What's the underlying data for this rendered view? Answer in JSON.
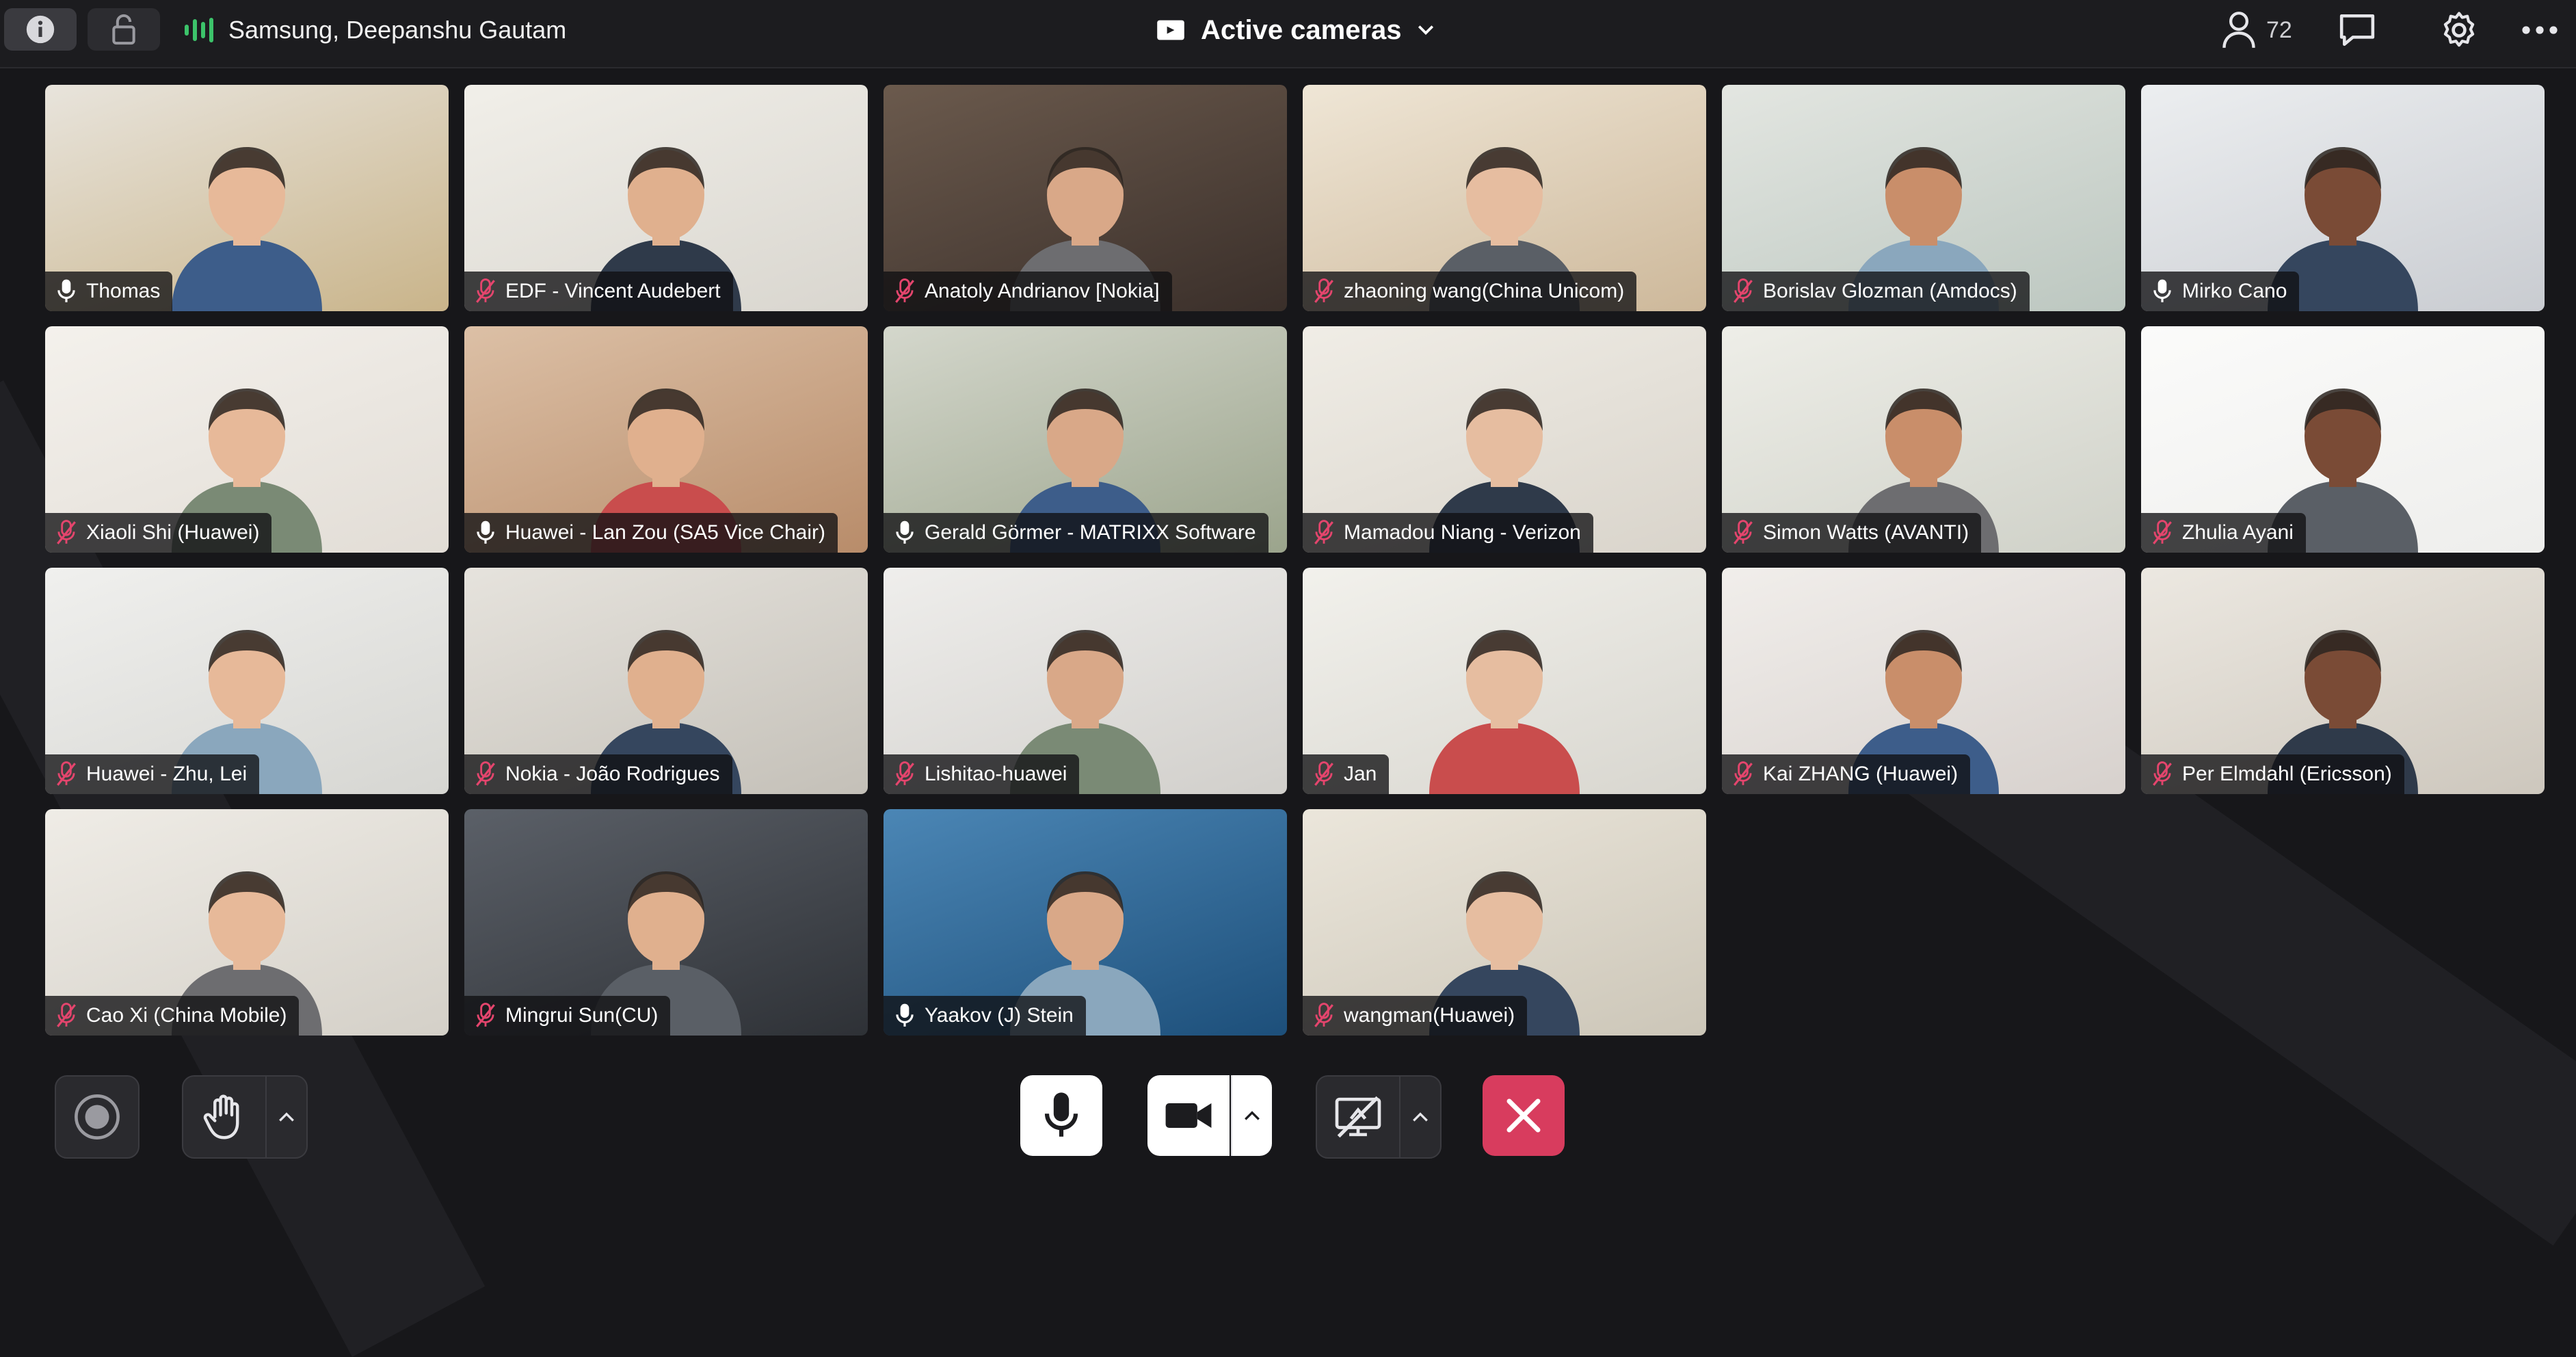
{
  "topbar": {
    "info_icon": "info-icon",
    "lock_icon": "lock-icon",
    "active_speakers": "Samsung, Deepanshu Gautam",
    "view_mode": "Active cameras",
    "participant_count": "72"
  },
  "colors": {
    "accent_red": "#d83c5e",
    "speaking_green": "#3cc36a",
    "background": "#17171a"
  },
  "participants": [
    {
      "name": "Thomas",
      "muted": false
    },
    {
      "name": "EDF - Vincent Audebert",
      "muted": true
    },
    {
      "name": "Anatoly Andrianov [Nokia]",
      "muted": true
    },
    {
      "name": "zhaoning wang(China Unicom)",
      "muted": true
    },
    {
      "name": "Borislav Glozman (Amdocs)",
      "muted": true
    },
    {
      "name": "Mirko Cano",
      "muted": false
    },
    {
      "name": "Xiaoli Shi (Huawei)",
      "muted": true
    },
    {
      "name": "Huawei - Lan Zou (SA5 Vice Chair)",
      "muted": false
    },
    {
      "name": "Gerald Görmer - MATRIXX Software",
      "muted": false
    },
    {
      "name": "Mamadou Niang - Verizon",
      "muted": true
    },
    {
      "name": "Simon Watts (AVANTI)",
      "muted": true
    },
    {
      "name": "Zhulia Ayani",
      "muted": true
    },
    {
      "name": "Huawei - Zhu, Lei",
      "muted": true
    },
    {
      "name": "Nokia - João Rodrigues",
      "muted": true
    },
    {
      "name": "Lishitao-huawei",
      "muted": true
    },
    {
      "name": "Jan",
      "muted": true
    },
    {
      "name": "Kai ZHANG (Huawei)",
      "muted": true
    },
    {
      "name": "Per Elmdahl (Ericsson)",
      "muted": true
    },
    {
      "name": "Cao Xi (China Mobile)",
      "muted": true
    },
    {
      "name": "Mingrui Sun(CU)",
      "muted": true
    },
    {
      "name": "Yaakov (J) Stein",
      "muted": false
    },
    {
      "name": "wangman(Huawei)",
      "muted": true
    }
  ],
  "controls": {
    "record": "record-icon",
    "raise_hand": "raise-hand-icon",
    "microphone": "microphone-icon",
    "camera": "video-camera-icon",
    "share_screen": "screen-share-off-icon",
    "leave": "close-icon"
  }
}
